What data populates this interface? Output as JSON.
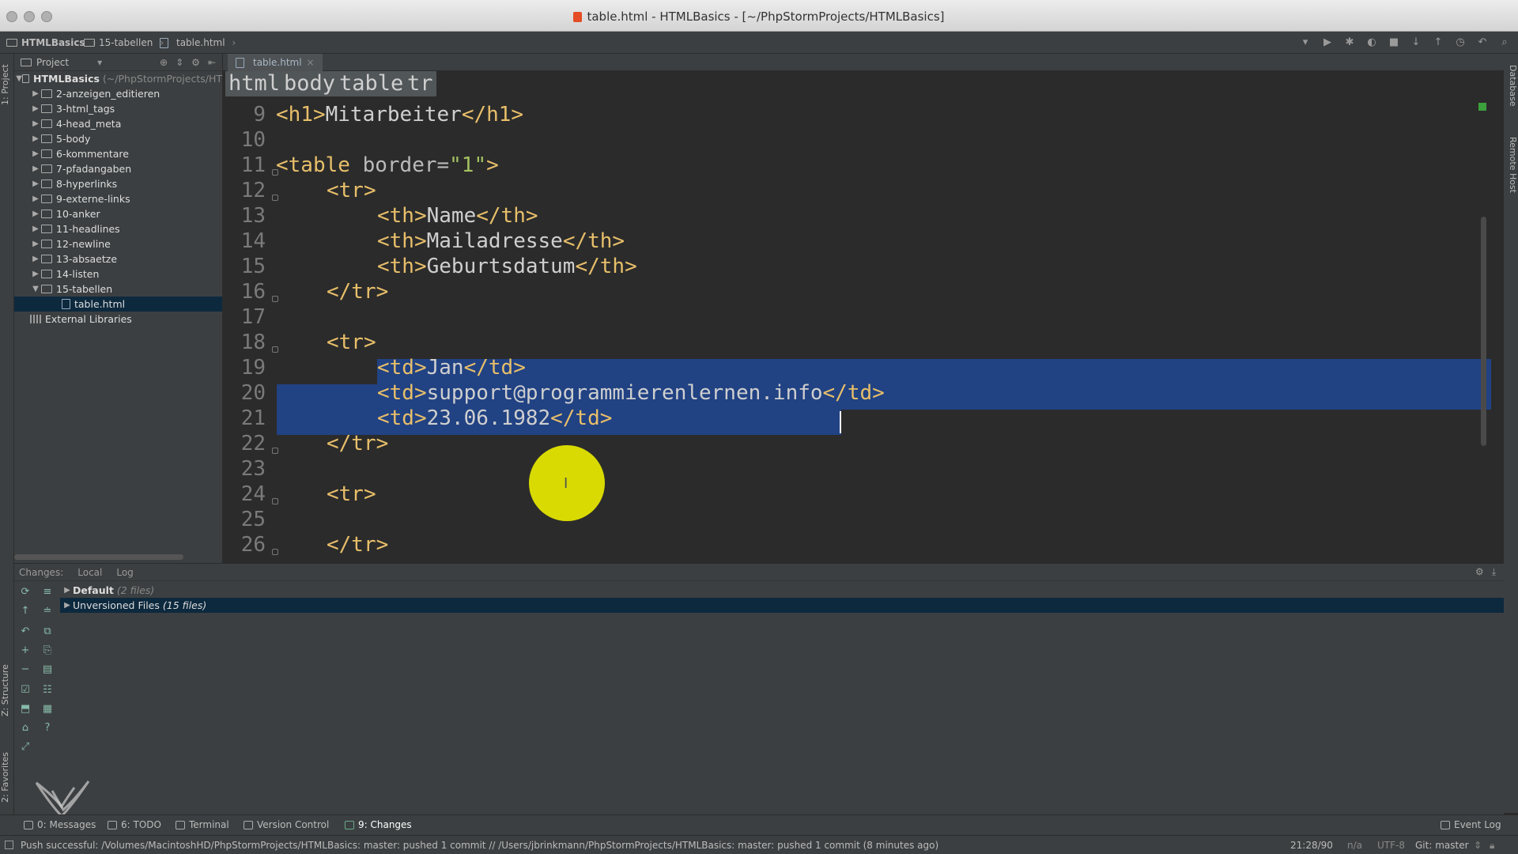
{
  "window": {
    "title": "table.html - HTMLBasics - [~/PhpStormProjects/HTMLBasics]"
  },
  "navbar": {
    "crumbs": [
      "HTMLBasics",
      "15-tabellen",
      "table.html"
    ]
  },
  "project_panel": {
    "header": "Project",
    "root": {
      "name": "HTMLBasics",
      "path": "(~/PhpStormProjects/HT"
    },
    "folders": [
      "2-anzeigen_editieren",
      "3-html_tags",
      "4-head_meta",
      "5-body",
      "6-kommentare",
      "7-pfadangaben",
      "8-hyperlinks",
      "9-externe-links",
      "10-anker",
      "11-headlines",
      "12-newline",
      "13-absaetze",
      "14-listen",
      "15-tabellen"
    ],
    "open_file": "table.html",
    "external": "External Libraries"
  },
  "left_strip": {
    "project_tab": "1: Project",
    "structure_tab": "Z: Structure",
    "favorites_tab": "2: Favorites"
  },
  "right_strip": {
    "database_tab": "Database",
    "remote_tab": "Remote Host"
  },
  "editor": {
    "tab": "table.html",
    "breadcrumbs": [
      "html",
      "body",
      "table",
      "tr"
    ],
    "line_numbers": [
      "9",
      "10",
      "11",
      "12",
      "13",
      "14",
      "15",
      "16",
      "17",
      "18",
      "19",
      "20",
      "21",
      "22",
      "23",
      "24",
      "25",
      "26"
    ],
    "lines": {
      "l9": {
        "open": "<h1>",
        "text": "Mitarbeiter",
        "close": "</h1>"
      },
      "l11": {
        "open": "<table ",
        "attr": "border=",
        "val": "\"1\"",
        "close": ">"
      },
      "l12": "<tr>",
      "l13": {
        "open": "<th>",
        "text": "Name",
        "close": "</th>"
      },
      "l14": {
        "open": "<th>",
        "text": "Mailadresse",
        "close": "</th>"
      },
      "l15": {
        "open": "<th>",
        "text": "Geburtsdatum",
        "close": "</th>"
      },
      "l16": "</tr>",
      "l18": "<tr>",
      "l19": {
        "open": "<td>",
        "text": "Jan",
        "close": "</td>"
      },
      "l20": {
        "open": "<td>",
        "text": "support@programmierenlernen.info",
        "close": "</td>"
      },
      "l21": {
        "open": "<td>",
        "text": "23.06.1982",
        "close": "</td>"
      },
      "l22": "</tr>",
      "l24": "<tr>",
      "l26": "</tr>"
    }
  },
  "changes_panel": {
    "label": "Changes:",
    "tabs": [
      "Local",
      "Log"
    ],
    "groups": [
      {
        "name": "Default",
        "count": "(2 files)"
      },
      {
        "name": "Unversioned Files",
        "count": "(15 files)"
      }
    ]
  },
  "bottom_tabs": [
    "0: Messages",
    "6: TODO",
    "Terminal",
    "Version Control",
    "9: Changes"
  ],
  "event_log": "Event Log",
  "status": {
    "message": "Push successful: /Volumes/MacintoshHD/PhpStormProjects/HTMLBasics: master: pushed 1 commit // /Users/jbrinkmann/PhpStormProjects/HTMLBasics: master: pushed 1 commit (8 minutes ago)",
    "position": "21:28/90",
    "na": "n/a",
    "encoding": "UTF-8",
    "git": "Git: master"
  },
  "colors": {
    "tag": "#e8bf6a",
    "text": "#cfcfcf",
    "value": "#a5c261",
    "selection": "#214283",
    "background": "#2b2b2b"
  }
}
